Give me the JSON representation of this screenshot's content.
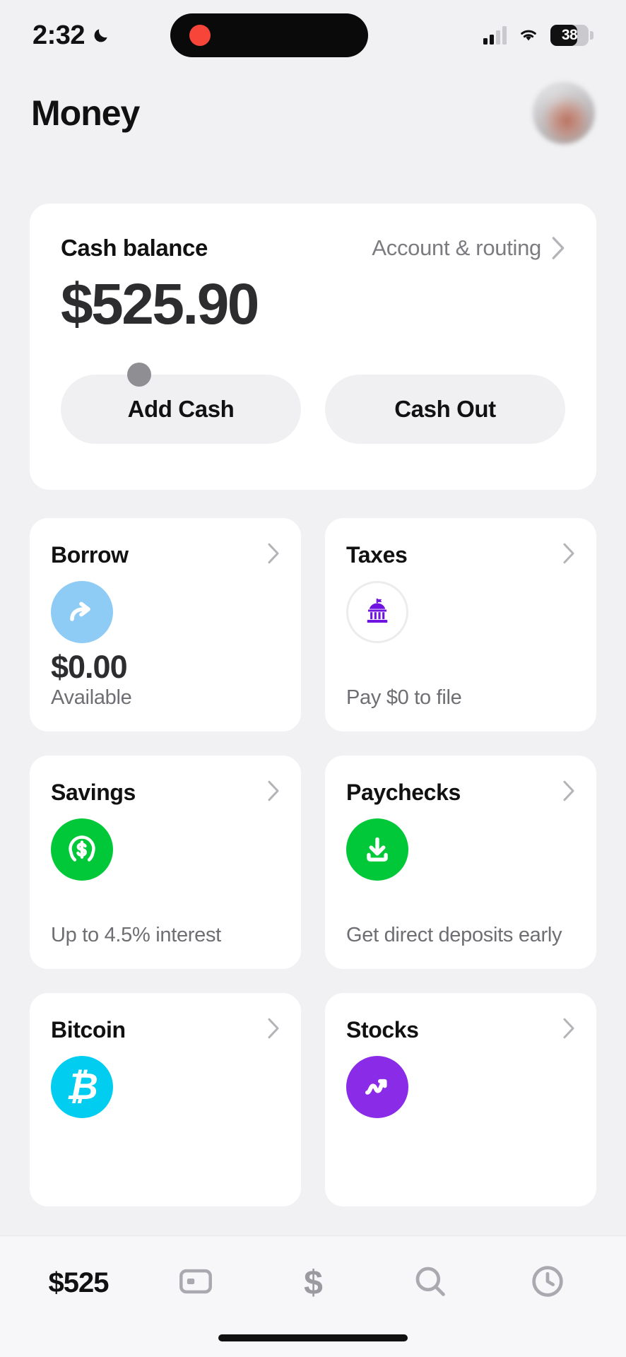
{
  "status_bar": {
    "time": "2:32",
    "dnd_icon": "moon-icon",
    "battery_percent": "38",
    "cellular_icon": "cellular-signal-icon",
    "wifi_icon": "wifi-icon",
    "recording_indicator": "recording-dot"
  },
  "header": {
    "title": "Money",
    "avatar": "user-avatar"
  },
  "balance_card": {
    "label": "Cash balance",
    "link_label": "Account & routing",
    "amount": "$525.90",
    "add_cash_label": "Add Cash",
    "cash_out_label": "Cash Out"
  },
  "tiles": [
    {
      "title": "Borrow",
      "icon": "curved-arrow-icon",
      "icon_color": "#8ecbf5",
      "big_value": "$0.00",
      "subtitle": "Available"
    },
    {
      "title": "Taxes",
      "icon": "government-building-icon",
      "icon_color": "#6f13e0",
      "big_value": "",
      "subtitle": "Pay $0 to file"
    },
    {
      "title": "Savings",
      "icon": "dollar-circle-icon",
      "icon_color": "#00c838",
      "big_value": "",
      "subtitle": "Up to 4.5% interest"
    },
    {
      "title": "Paychecks",
      "icon": "download-arrow-icon",
      "icon_color": "#00c838",
      "big_value": "",
      "subtitle": "Get direct deposits early"
    },
    {
      "title": "Bitcoin",
      "icon": "bitcoin-icon",
      "icon_color": "#00cdf0",
      "big_value": "",
      "subtitle": ""
    },
    {
      "title": "Stocks",
      "icon": "trend-arrow-icon",
      "icon_color": "#8a2be8",
      "big_value": "",
      "subtitle": ""
    }
  ],
  "tab_bar": {
    "money_label": "$525",
    "card_icon": "card-icon",
    "payments_icon": "dollar-sign-icon",
    "search_icon": "search-icon",
    "activity_icon": "clock-icon"
  },
  "colors": {
    "background": "#f1f1f3",
    "card": "#ffffff",
    "accent_green": "#00c838",
    "accent_purple": "#8a2be8",
    "accent_cyan": "#00cdf0",
    "accent_blue": "#8ecbf5",
    "tax_purple": "#6f13e0",
    "text_primary": "#111111",
    "text_secondary": "#6e6e73"
  }
}
